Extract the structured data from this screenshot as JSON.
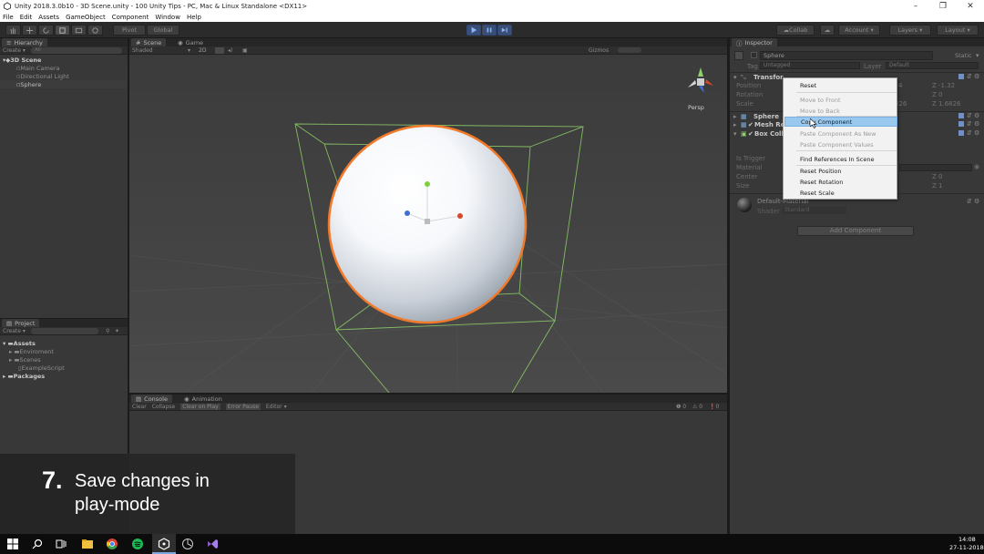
{
  "window": {
    "title": "Unity 2018.3.0b10 - 3D Scene.unity - 100 Unity Tips - PC, Mac & Linux Standalone <DX11>"
  },
  "menu": [
    "File",
    "Edit",
    "Assets",
    "GameObject",
    "Component",
    "Window",
    "Help"
  ],
  "toolbar": {
    "pivot": "Pivot",
    "global": "Global",
    "collab": "Collab",
    "account": "Account",
    "layers": "Layers",
    "layout": "Layout"
  },
  "hierarchy": {
    "tab": "Hierarchy",
    "create": "Create",
    "search": "All",
    "scene": "3D Scene",
    "items": [
      "Main Camera",
      "Directional Light",
      "Sphere"
    ]
  },
  "scene": {
    "tab": "Scene",
    "game_tab": "Game",
    "shading": "Shaded",
    "mode": "2D",
    "gizmos": "Gizmos",
    "persp": "Persp"
  },
  "project": {
    "tab": "Project",
    "create": "Create",
    "assets": "Assets",
    "folders": [
      "Enviroment",
      "Scenes"
    ],
    "script": "ExampleScript",
    "packages": "Packages"
  },
  "console": {
    "tab": "Console",
    "animation_tab": "Animation",
    "buttons": [
      "Clear",
      "Collapse",
      "Clear on Play",
      "Error Pause",
      "Editor"
    ],
    "count": "0"
  },
  "inspector": {
    "tab": "Inspector",
    "object_name": "Sphere",
    "static": "Static",
    "tag_label": "Tag",
    "tag_value": "Untagged",
    "layer_label": "Layer",
    "layer_value": "Default",
    "transform": "Transfor",
    "position": "Position",
    "rotation": "Rotation",
    "scale": "Scale",
    "pos_z": "Z  -1.32",
    "rot_z": "Z  0",
    "scale_z": "Z  1.6826",
    "pos_y_frag": "4",
    "scale_frag": "826",
    "mesh_filter": "Sphere",
    "mesh_renderer": "Mesh Re",
    "box_collider": "Box Coll",
    "is_trigger": "Is Trigger",
    "material": "Material",
    "center": "Center",
    "size": "Size",
    "center_z": "Z  0",
    "size_z": "Z  1",
    "default_material": "Default-Material",
    "shader_label": "Shader",
    "shader_value": "Standard",
    "add_component": "Add Component"
  },
  "context_menu": {
    "items": [
      {
        "label": "Reset",
        "enabled": true
      },
      {
        "label": "Move to Front",
        "enabled": false
      },
      {
        "label": "Move to Back",
        "enabled": false
      },
      {
        "label": "Copy Component",
        "enabled": true,
        "highlighted": true
      },
      {
        "label": "Paste Component As New",
        "enabled": false
      },
      {
        "label": "Paste Component Values",
        "enabled": false
      },
      {
        "label": "Find References In Scene",
        "enabled": true
      },
      {
        "label": "Reset Position",
        "enabled": true
      },
      {
        "label": "Reset Rotation",
        "enabled": true
      },
      {
        "label": "Reset Scale",
        "enabled": true
      }
    ]
  },
  "caption": {
    "number": "7.",
    "line1": "Save changes in",
    "line2": "play-mode"
  },
  "taskbar": {
    "time": "14:08",
    "date": "27-11-2018"
  },
  "colors": {
    "accent": "#3e7de0",
    "selection_orange": "#f07a2a",
    "bounds_green": "#8fd16a"
  }
}
